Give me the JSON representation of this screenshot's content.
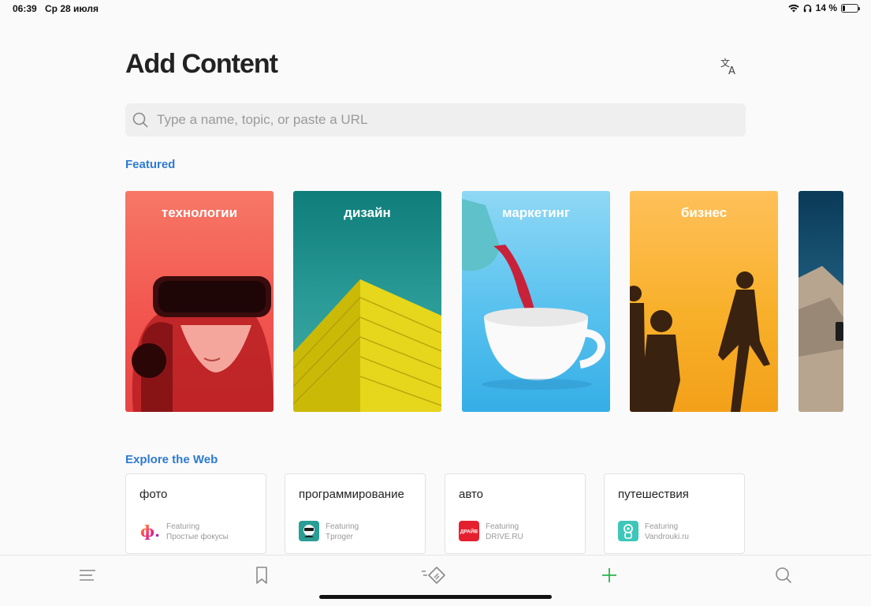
{
  "status_bar": {
    "time": "06:39",
    "date": "Ср 28 июля",
    "battery_text": "14 %",
    "battery_level": 0.14
  },
  "header": {
    "title": "Add Content",
    "translate_icon": "translate-icon"
  },
  "search": {
    "placeholder": "Type a name, topic, or paste a URL",
    "value": ""
  },
  "featured": {
    "label": "Featured",
    "cards": [
      {
        "label": "технологии",
        "image": "vr-headset"
      },
      {
        "label": "дизайн",
        "image": "yellow-building"
      },
      {
        "label": "маркетинг",
        "image": "teapot-cup"
      },
      {
        "label": "бизнес",
        "image": "walking-silhouettes"
      },
      {
        "label": "",
        "image": "aerial-landscape"
      }
    ]
  },
  "explore": {
    "label": "Explore the Web",
    "cards": [
      {
        "title": "фото",
        "featuring": "Featuring",
        "source": "Простые фокусы",
        "logo_text": "ф.",
        "logo_color": "#ffffff"
      },
      {
        "title": "программирование",
        "featuring": "Featuring",
        "source": "Tproger",
        "logo_text": "",
        "logo_color": "#2a9d95"
      },
      {
        "title": "авто",
        "featuring": "Featuring",
        "source": "DRIVE.RU",
        "logo_text": "ДРАЙВ",
        "logo_color": "#e5202e"
      },
      {
        "title": "путешествия",
        "featuring": "Featuring",
        "source": "Vandrouki.ru",
        "logo_text": "",
        "logo_color": "#3ec6b8"
      }
    ]
  },
  "tab_bar": {
    "items": [
      "menu-icon",
      "bookmark-icon",
      "feedly-icon",
      "add-icon",
      "search-icon"
    ],
    "active_color": "#2bb24c"
  },
  "colors": {
    "accent": "#2d7bd1",
    "add_green": "#2bb24c"
  }
}
